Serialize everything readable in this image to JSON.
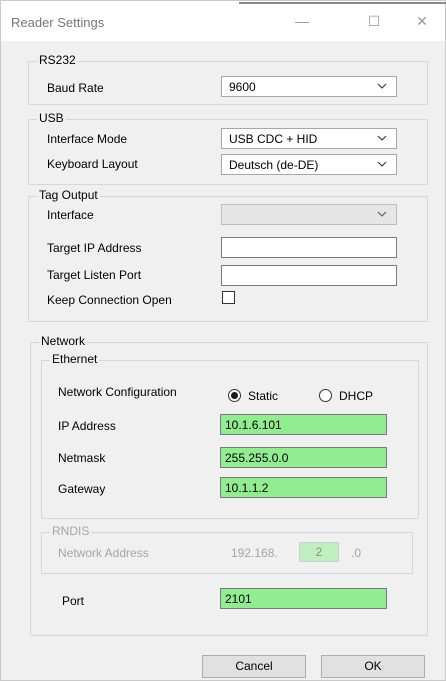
{
  "window": {
    "title": "Reader Settings",
    "minimize_glyph": "—",
    "maximize_glyph": "☐",
    "close_glyph": "✕"
  },
  "rs232": {
    "group_title": "RS232",
    "baud_rate_label": "Baud Rate",
    "baud_rate_value": "9600"
  },
  "usb": {
    "group_title": "USB",
    "interface_mode_label": "Interface Mode",
    "interface_mode_value": "USB CDC + HID",
    "keyboard_layout_label": "Keyboard Layout",
    "keyboard_layout_value": "Deutsch (de-DE)"
  },
  "tag_output": {
    "group_title": "Tag Output",
    "interface_label": "Interface",
    "interface_value": "",
    "target_ip_label": "Target IP Address",
    "target_ip_value": "",
    "target_port_label": "Target Listen Port",
    "target_port_value": "",
    "keep_open_label": "Keep Connection Open",
    "keep_open_checked": false
  },
  "network": {
    "group_title": "Network",
    "ethernet": {
      "group_title": "Ethernet",
      "config_label": "Network Configuration",
      "static_label": "Static",
      "dhcp_label": "DHCP",
      "selected": "Static",
      "ip_label": "IP Address",
      "ip_value": "10.1.6.101",
      "netmask_label": "Netmask",
      "netmask_value": "255.255.0.0",
      "gateway_label": "Gateway",
      "gateway_value": "10.1.1.2"
    },
    "rndis": {
      "group_title": "RNDIS",
      "address_label": "Network Address",
      "address_prefix": "192.168.",
      "address_octet": "2",
      "address_suffix": ".0"
    },
    "port_label": "Port",
    "port_value": "2101"
  },
  "buttons": {
    "cancel": "Cancel",
    "ok": "OK"
  },
  "colors": {
    "highlight_input": "#90ee90",
    "dialog_bg": "#f0f0f0"
  }
}
